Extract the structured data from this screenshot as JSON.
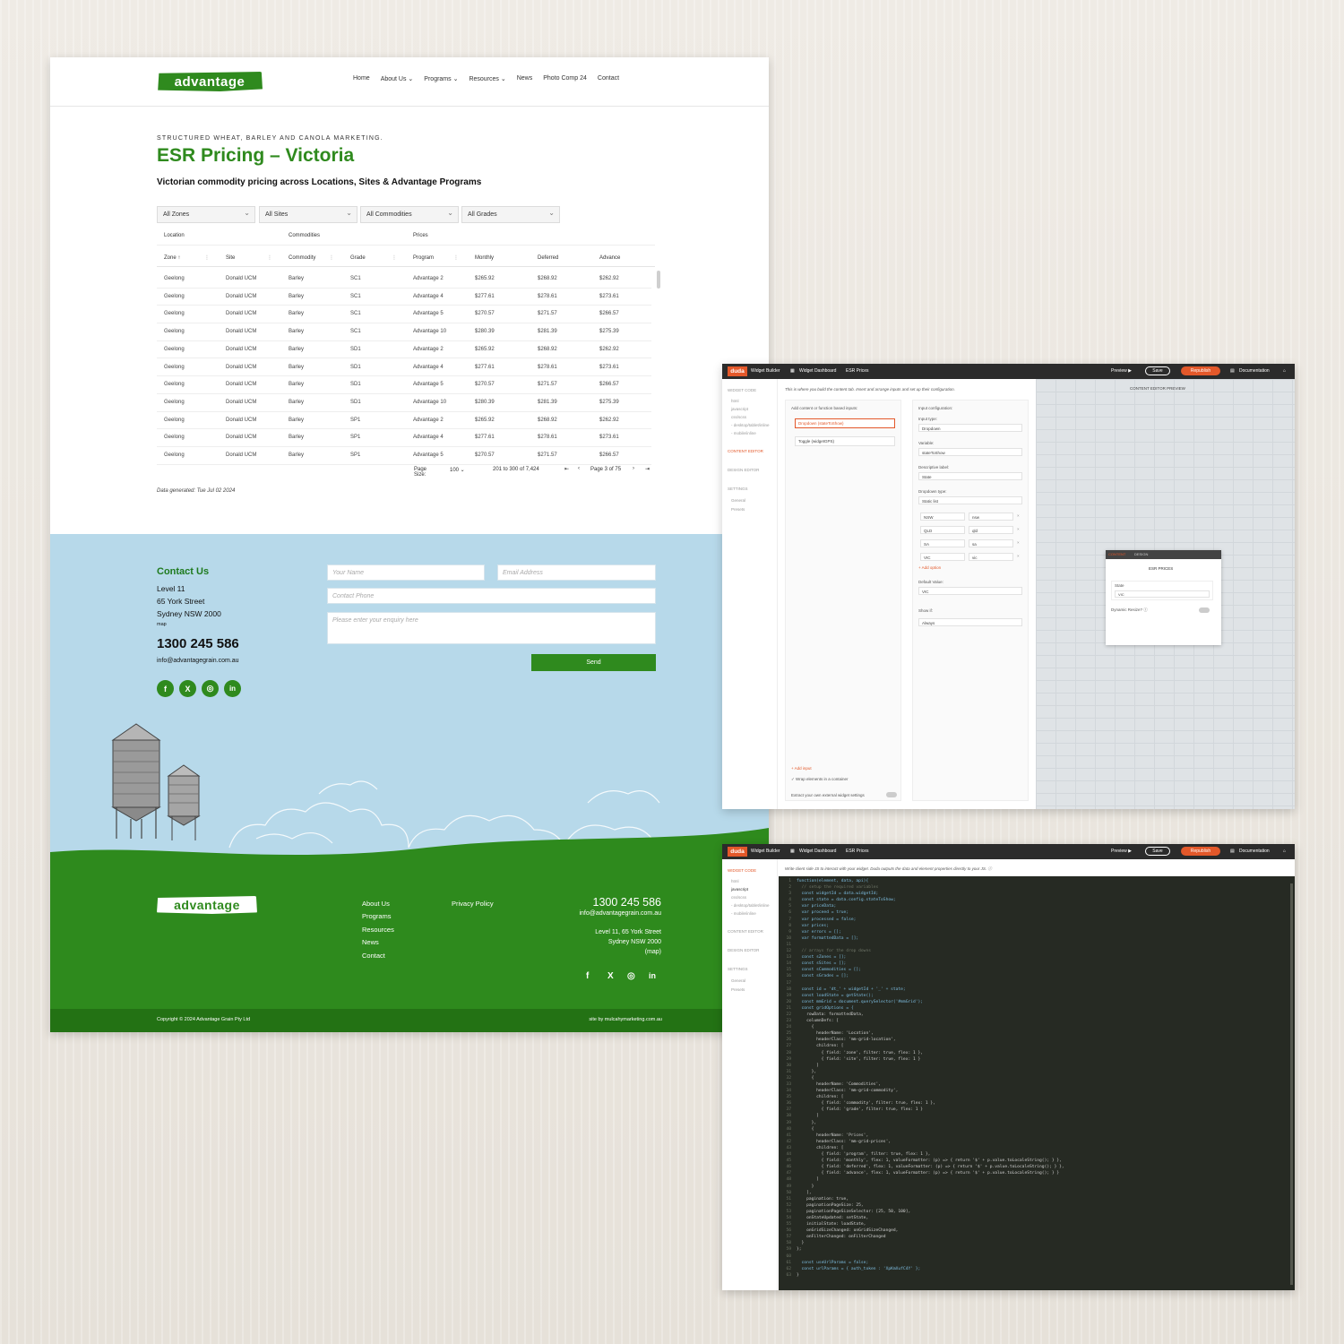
{
  "site": {
    "logo": "advantage",
    "nav": [
      "Home",
      "About Us ⌄",
      "Programs ⌄",
      "Resources ⌄",
      "News",
      "Photo Comp 24",
      "Contact"
    ],
    "eyebrow": "STRUCTURED WHEAT, BARLEY AND CANOLA MARKETING.",
    "title": "ESR Pricing – Victoria",
    "subtitle": "Victorian commodity pricing across Locations, Sites & Advantage Programs",
    "filters": [
      "All Zones",
      "All Sites",
      "All Commodities",
      "All Grades"
    ],
    "grid": {
      "groups": [
        "Location",
        "Commodities",
        "Prices"
      ],
      "columns": [
        "Zone ↑",
        "Site",
        "Commodity",
        "Grade",
        "Program",
        "Monthly",
        "Deferred",
        "Advance"
      ],
      "rows": [
        [
          "Geelong",
          "Donald UCM",
          "Barley",
          "SC1",
          "Advantage 2",
          "$265.92",
          "$268.92",
          "$262.92"
        ],
        [
          "Geelong",
          "Donald UCM",
          "Barley",
          "SC1",
          "Advantage 4",
          "$277.61",
          "$278.61",
          "$273.61"
        ],
        [
          "Geelong",
          "Donald UCM",
          "Barley",
          "SC1",
          "Advantage 5",
          "$270.57",
          "$271.57",
          "$266.57"
        ],
        [
          "Geelong",
          "Donald UCM",
          "Barley",
          "SC1",
          "Advantage 10",
          "$280.39",
          "$281.39",
          "$275.39"
        ],
        [
          "Geelong",
          "Donald UCM",
          "Barley",
          "SD1",
          "Advantage 2",
          "$265.92",
          "$268.92",
          "$262.92"
        ],
        [
          "Geelong",
          "Donald UCM",
          "Barley",
          "SD1",
          "Advantage 4",
          "$277.61",
          "$278.61",
          "$273.61"
        ],
        [
          "Geelong",
          "Donald UCM",
          "Barley",
          "SD1",
          "Advantage 5",
          "$270.57",
          "$271.57",
          "$266.57"
        ],
        [
          "Geelong",
          "Donald UCM",
          "Barley",
          "SD1",
          "Advantage 10",
          "$280.39",
          "$281.39",
          "$275.39"
        ],
        [
          "Geelong",
          "Donald UCM",
          "Barley",
          "SP1",
          "Advantage 2",
          "$265.92",
          "$268.92",
          "$262.92"
        ],
        [
          "Geelong",
          "Donald UCM",
          "Barley",
          "SP1",
          "Advantage 4",
          "$277.61",
          "$278.61",
          "$273.61"
        ],
        [
          "Geelong",
          "Donald UCM",
          "Barley",
          "SP1",
          "Advantage 5",
          "$270.57",
          "$271.57",
          "$266.57"
        ]
      ],
      "pager": {
        "page_size_label": "Page Size:",
        "page_size": "100 ⌄",
        "range": "201 to 300 of 7,424",
        "page": "Page 3 of 75"
      }
    },
    "date_generated": "Data generated: Tue Jul 02 2024",
    "contact": {
      "title": "Contact Us",
      "address": [
        "Level 11",
        "65 York Street",
        "Sydney NSW 2000"
      ],
      "map": "map",
      "phone": "1300 245 586",
      "email": "info@advantagegrain.com.au",
      "placeholders": {
        "name": "Your Name",
        "email": "Email Address",
        "phone": "Contact Phone",
        "enquiry": "Please enter your enquiry here"
      },
      "send": "Send"
    },
    "footer": {
      "links": [
        "About Us",
        "Programs",
        "Resources",
        "News",
        "Contact"
      ],
      "privacy": "Privacy Policy",
      "phone": "1300 245 586",
      "email": "info@advantagegrain.com.au",
      "address1": "Level 11, 65 York Street",
      "address2": "Sydney NSW 2000",
      "map": "(map)",
      "copyright": "Copyright © 2024 Advantage Grain Pty Ltd",
      "credit": "site by mulcahymarketing.com.au"
    },
    "colors": {
      "brand_green": "#2f8a1e",
      "sky": "#b7d9ea",
      "grass": "#2e8a1d"
    }
  },
  "duda": {
    "logo": "duda",
    "widget_builder": "Widget Builder",
    "dashboard": "Widget Dashboard",
    "widget_name": "ESR Prices",
    "preview": "Preview ▶",
    "save": "Save",
    "publish": "Republish",
    "docs": "Documentation",
    "sidebar": {
      "widget_code": "WIDGET CODE",
      "code_items": [
        "html",
        "javascript",
        "css/scss",
        "- desktop/tablet/inline",
        "- mobile/inline"
      ],
      "content_editor": "CONTENT EDITOR",
      "design_editor": "DESIGN EDITOR",
      "settings": "SETTINGS",
      "settings_items": [
        "General",
        "Presets"
      ]
    },
    "editor": {
      "intro": "This is where you build the content tab. Insert and arrange inputs and set up their configuration.",
      "add_label": "Add content or function based inputs:",
      "inputs": [
        "Dropdown (stateToShow)",
        "Toggle (widgetGPS)"
      ],
      "add_input": "+ Add input",
      "wrap": "Wrap elements in a container",
      "extract": "Extract your own external widget settings",
      "config_title": "Input configuration:",
      "input_type_label": "Input type:",
      "input_type": "Dropdown",
      "variable_label": "Variable:",
      "variable": "stateToShow",
      "desc_label": "Descriptive label:",
      "desc": "State",
      "dd_type_label": "Dropdown type:",
      "dd_type": "Static list",
      "options": [
        [
          "NSW",
          "nsw"
        ],
        [
          "QLD",
          "qld"
        ],
        [
          "SA",
          "sa"
        ],
        [
          "VIC",
          "vic"
        ]
      ],
      "add_option": "+ Add option",
      "default_label": "Default Value:",
      "default": "VIC",
      "show_label": "Show if:",
      "show": "Always",
      "preview_title": "CONTENT EDITOR PREVIEW",
      "popup_tabs": [
        "CONTENT",
        "DESIGN"
      ],
      "popup_title": "ESR PRICES",
      "popup_state": "State",
      "popup_value": "VIC",
      "popup_resize": "Dynamic Resize?  ⓘ"
    },
    "code": {
      "intro": "Write client side JS to interact with your widget. Duda outputs the data and element properties directly to your JS.  ⓘ",
      "lines": [
        "function(element, data, api){",
        "  // setup the required variables",
        "  const widgetId = data.widgetId;",
        "  const state = data.config.stateToShow;",
        "  var priceData;",
        "  var proceed = true;",
        "  var processed = false;",
        "  var prices;",
        "  var errors = [];",
        "  var formattedData = [];",
        "",
        "  // arrays for the drop downs",
        "  const sZones = [];",
        "  const sSites = [];",
        "  const sCommodities = [];",
        "  const sGrades = [];",
        "",
        "  const id = 'dt_' + widgetId + '_' + state;",
        "  const loadState = getState();",
        "  const mmGrid = document.querySelector('#mmGrid');",
        "  const gridOptions = {",
        "    rowData: formattedData,",
        "    columnDefs: [",
        "      {",
        "        headerName: 'Location',",
        "        headerClass: 'mm-grid-location',",
        "        children: [",
        "          { field: 'zone', filter: true, flex: 1 },",
        "          { field: 'site', filter: true, flex: 1 }",
        "        ]",
        "      },",
        "      {",
        "        headerName: 'Commodities',",
        "        headerClass: 'mm-grid-commodity',",
        "        children: [",
        "          { field: 'commodity', filter: true, flex: 1 },",
        "          { field: 'grade', filter: true, flex: 1 }",
        "        ]",
        "      },",
        "      {",
        "        headerName: 'Prices',",
        "        headerClass: 'mm-grid-prices',",
        "        children: [",
        "          { field: 'program', filter: true, flex: 1 },",
        "          { field: 'monthly', flex: 1, valueFormatter: (p) => { return '$' + p.value.toLocaleString(); } },",
        "          { field: 'deferred', flex: 1, valueFormatter: (p) => { return '$' + p.value.toLocaleString(); } },",
        "          { field: 'advance', flex: 1, valueFormatter: (p) => { return '$' + p.value.toLocaleString(); } }",
        "        ]",
        "      }",
        "    ],",
        "    pagination: true,",
        "    paginationPageSize: 25,",
        "    paginationPageSizeSelector: [25, 50, 100],",
        "    onStateUpdated: setState,",
        "    initialState: loadState,",
        "    onGridSizeChanged: onGridSizeChanged,",
        "    onFilterChanged: onFilterChanged",
        "  }",
        "};",
        "",
        "  const useUrlParams = false;",
        "  const urlParams = { auth_token : 'XpKmXufC4Y' };",
        "}"
      ]
    }
  }
}
